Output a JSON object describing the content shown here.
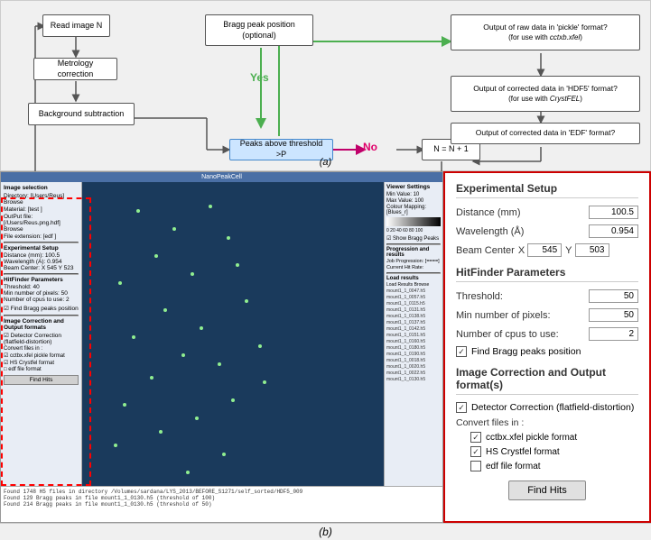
{
  "flowchart": {
    "nodes": {
      "read_image": "Read image N",
      "metrology": "Metrology correction",
      "background": "Background subtraction",
      "bragg": "Bragg peak position\n(optional)",
      "peaks_above": "Peaks above threshold >P",
      "yes_label": "Yes",
      "no_label": "No",
      "n_next": "N = N + 1",
      "output1": "Output of raw data in 'pickle' format?\n(for use with cctxb.xfel)",
      "output2": "Output of corrected data in 'HDF5' format?\n(for use with CrystFEL)",
      "output3": "Output of corrected data in 'EDF' format?"
    },
    "figure_label": "(a)"
  },
  "bottom": {
    "figure_label": "(b)",
    "expanded_panel": {
      "title": "Experimental Setup",
      "distance_label": "Distance (mm)",
      "distance_value": "100.5",
      "wavelength_label": "Wavelength (Å)",
      "wavelength_value": "0.954",
      "beam_center_label": "Beam Center",
      "beam_x_label": "X",
      "beam_x_value": "545",
      "beam_y_label": "Y",
      "beam_y_value": "503",
      "hitfinder_title": "HitFinder Parameters",
      "threshold_label": "Threshold:",
      "threshold_value": "50",
      "min_pixels_label": "Min number of pixels:",
      "min_pixels_value": "50",
      "num_cpus_label": "Number of cpus to use:",
      "num_cpus_value": "2",
      "find_bragg_label": "Find Bragg peaks position",
      "correction_title": "Image Correction and Output format(s)",
      "detector_label": "Detector Correction (flatfield-distortion)",
      "convert_label": "Convert files in :",
      "cctxb_label": "cctbx.xfel pickle format",
      "hs_label": "HS Crystfel format",
      "edf_label": "edf file format",
      "find_hits_btn": "Find Hits"
    },
    "app_title": "NanoPeakCell",
    "log_messages": [
      "Found 1748 H5 files in directory /Volumes/sardana/LYS_2013/BEFORE_S1271/self_sorted/HDF5_009",
      "Found 129 Bragg peaks in file mount1_1_0130.h5 (threshold of 100)",
      "Found 214 Bragg peaks in file mount1_1_0130.h5 (threshold of 50)"
    ]
  }
}
